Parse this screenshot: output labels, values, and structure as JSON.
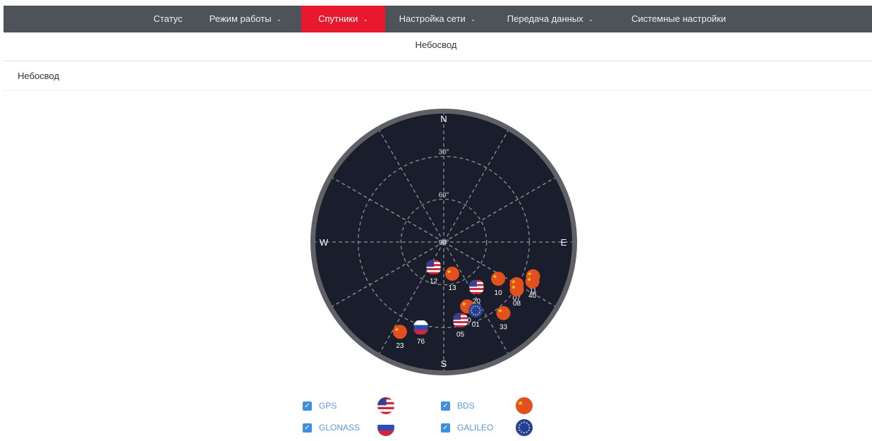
{
  "nav": {
    "items": [
      {
        "label": "Статус",
        "dropdown": false,
        "active": false
      },
      {
        "label": "Режим работы",
        "dropdown": true,
        "active": false
      },
      {
        "label": "Спутники",
        "dropdown": true,
        "active": true
      },
      {
        "label": "Настройка сети",
        "dropdown": true,
        "active": false
      },
      {
        "label": "Передача данных",
        "dropdown": true,
        "active": false
      },
      {
        "label": "Системные настройки",
        "dropdown": false,
        "active": false
      }
    ]
  },
  "subtab": "Небосвод",
  "panel": {
    "title": "Небосвод"
  },
  "skyplot": {
    "directions": {
      "north": "N",
      "east": "E",
      "south": "S",
      "west": "W"
    },
    "elevation_labels": [
      "30°",
      "60°",
      "90°"
    ],
    "colors": {
      "background": "#1a1d2b",
      "ring": "#5f6166",
      "grid": "#8c8f96"
    },
    "satellites": [
      {
        "id": "12",
        "system": "GPS",
        "azimuth": 202,
        "elevation": 71
      },
      {
        "id": "13",
        "system": "BDS",
        "azimuth": 165,
        "elevation": 67
      },
      {
        "id": "20",
        "system": "GPS",
        "azimuth": 144,
        "elevation": 51
      },
      {
        "id": "10",
        "system": "BDS",
        "azimuth": 124,
        "elevation": 44
      },
      {
        "id": "07",
        "system": "BDS",
        "azimuth": 120,
        "elevation": 31
      },
      {
        "id": "11",
        "system": "BDS",
        "azimuth": 111,
        "elevation": 23
      },
      {
        "id": "40",
        "system": "BDS",
        "azimuth": 114,
        "elevation": 22
      },
      {
        "id": "08",
        "system": "BDS",
        "azimuth": 123,
        "elevation": 29
      },
      {
        "id": "60",
        "system": "BDS",
        "azimuth": 160,
        "elevation": 42
      },
      {
        "id": "01",
        "system": "GALILEO",
        "azimuth": 155,
        "elevation": 37
      },
      {
        "id": "05",
        "system": "GPS",
        "azimuth": 168,
        "elevation": 34
      },
      {
        "id": "33",
        "system": "BDS",
        "azimuth": 140,
        "elevation": 25
      },
      {
        "id": "76",
        "system": "GLONASS",
        "azimuth": 195,
        "elevation": 28
      },
      {
        "id": "23",
        "system": "BDS",
        "azimuth": 206,
        "elevation": 20
      }
    ]
  },
  "legend": [
    {
      "label": "GPS",
      "checked": true,
      "flag": "us-flag-icon"
    },
    {
      "label": "BDS",
      "checked": true,
      "flag": "cn-flag-icon"
    },
    {
      "label": "GLONASS",
      "checked": true,
      "flag": "ru-flag-icon"
    },
    {
      "label": "GALILEO",
      "checked": true,
      "flag": "eu-flag-icon"
    }
  ]
}
